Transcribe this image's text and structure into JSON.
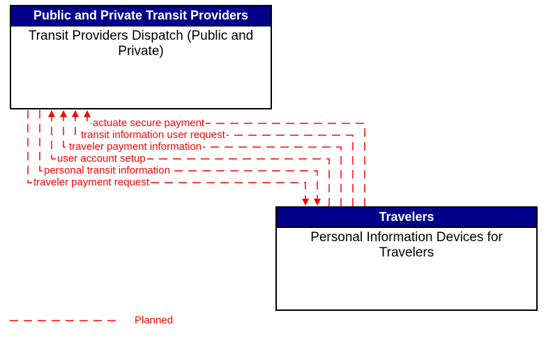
{
  "entities": {
    "top": {
      "header": "Public and Private Transit Providers",
      "body": "Transit Providers Dispatch (Public and Private)"
    },
    "bottom": {
      "header": "Travelers",
      "body": "Personal Information Devices for Travelers"
    }
  },
  "flows": {
    "f1": {
      "label": "actuate secure payment"
    },
    "f2": {
      "label": "transit information user request"
    },
    "f3": {
      "label": "traveler payment information"
    },
    "f4": {
      "label": "user account setup"
    },
    "f5": {
      "label": "personal transit information"
    },
    "f6": {
      "label": "traveler payment request"
    }
  },
  "legend": {
    "label": "Planned"
  },
  "colors": {
    "header_bg": "#00008b",
    "flow_color": "#ff0000"
  },
  "chart_data": {
    "type": "diagram",
    "nodes": [
      {
        "id": "transit_dispatch",
        "group": "Public and Private Transit Providers",
        "label": "Transit Providers Dispatch (Public and Private)"
      },
      {
        "id": "personal_devices",
        "group": "Travelers",
        "label": "Personal Information Devices for Travelers"
      }
    ],
    "edges": [
      {
        "from": "personal_devices",
        "to": "transit_dispatch",
        "label": "actuate secure payment",
        "status": "planned"
      },
      {
        "from": "personal_devices",
        "to": "transit_dispatch",
        "label": "transit information user request",
        "status": "planned"
      },
      {
        "from": "personal_devices",
        "to": "transit_dispatch",
        "label": "traveler payment information",
        "status": "planned"
      },
      {
        "from": "personal_devices",
        "to": "transit_dispatch",
        "label": "user account setup",
        "status": "planned"
      },
      {
        "from": "transit_dispatch",
        "to": "personal_devices",
        "label": "personal transit information",
        "status": "planned"
      },
      {
        "from": "transit_dispatch",
        "to": "personal_devices",
        "label": "traveler payment request",
        "status": "planned"
      }
    ],
    "legend": [
      {
        "style": "dashed-red",
        "meaning": "Planned"
      }
    ]
  }
}
